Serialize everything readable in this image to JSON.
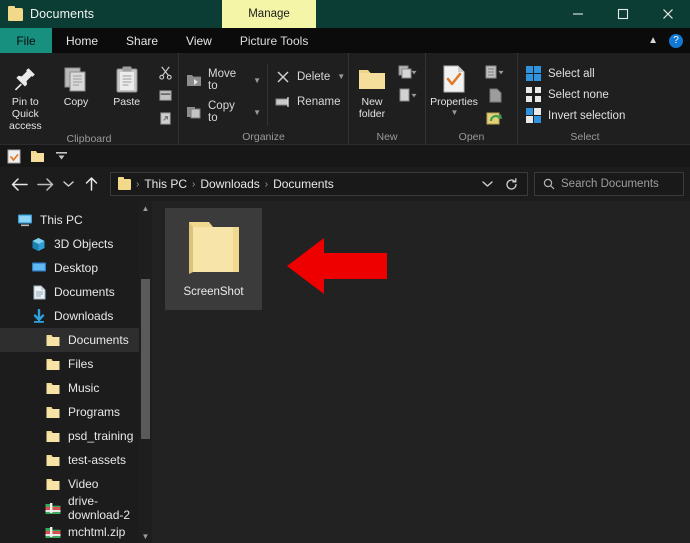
{
  "window": {
    "title": "Documents",
    "title_icon": "folder-icon",
    "contextual_tab": "Manage",
    "controls": {
      "minimize": "minimize-icon",
      "maximize": "maximize-icon",
      "close": "close-icon"
    },
    "accent_titlebar_color": "#0c3d34",
    "contextual_tab_color": "#f5f5a8"
  },
  "tabs": [
    {
      "label": "File",
      "active": true,
      "color": "#17907f"
    },
    {
      "label": "Home",
      "active": false
    },
    {
      "label": "Share",
      "active": false
    },
    {
      "label": "View",
      "active": false
    },
    {
      "label": "Picture Tools",
      "active": false
    }
  ],
  "tabstrip_right": {
    "collapse_ribbon": "chevron-up-icon",
    "help": "help-icon"
  },
  "ribbon": {
    "groups": [
      {
        "label": "Clipboard",
        "big_buttons": [
          {
            "label": "Pin to Quick access",
            "icon": "pin-icon"
          },
          {
            "label": "Copy",
            "icon": "copy-icon"
          },
          {
            "label": "Paste",
            "icon": "paste-icon"
          }
        ],
        "small_buttons": [
          {
            "name": "cut-icon",
            "tooltip": "Cut"
          },
          {
            "name": "copy-path-icon",
            "tooltip": "Copy path"
          },
          {
            "name": "paste-shortcut-icon",
            "tooltip": "Paste shortcut"
          }
        ]
      },
      {
        "label": "Organize",
        "items": [
          {
            "label": "Move to",
            "icon": "move-to-icon",
            "has_caret": true
          },
          {
            "label": "Copy to",
            "icon": "copy-to-icon",
            "has_caret": true
          },
          {
            "label": "Delete",
            "icon": "delete-icon",
            "has_caret": true
          },
          {
            "label": "Rename",
            "icon": "rename-icon",
            "has_caret": false
          }
        ]
      },
      {
        "label": "New",
        "big_buttons": [
          {
            "label": "New folder",
            "icon": "new-folder-icon"
          }
        ],
        "small_buttons": [
          {
            "name": "new-item-icon",
            "tooltip": "New item",
            "has_caret": true
          },
          {
            "name": "easy-access-icon",
            "tooltip": "Easy access",
            "has_caret": true
          }
        ]
      },
      {
        "label": "Open",
        "big_buttons": [
          {
            "label": "Properties",
            "icon": "properties-icon",
            "has_caret": true
          }
        ],
        "small_buttons": [
          {
            "name": "open-icon",
            "tooltip": "Open",
            "has_caret": true
          },
          {
            "name": "edit-icon",
            "tooltip": "Edit"
          },
          {
            "name": "history-icon",
            "tooltip": "History"
          }
        ]
      },
      {
        "label": "Select",
        "items": [
          {
            "label": "Select all",
            "icon": "select-all-icon"
          },
          {
            "label": "Select none",
            "icon": "select-none-icon"
          },
          {
            "label": "Invert selection",
            "icon": "invert-selection-icon"
          }
        ]
      }
    ]
  },
  "quick_access": [
    {
      "name": "properties-icon"
    },
    {
      "name": "new-folder-icon"
    },
    {
      "name": "customize-dropdown-icon"
    }
  ],
  "address_bar": {
    "back": "back-arrow-icon",
    "forward": "forward-arrow-icon",
    "recent": "chevron-down-icon",
    "up": "up-arrow-icon",
    "path_icon": "folder-icon",
    "breadcrumbs": [
      "This PC",
      "Downloads",
      "Documents"
    ],
    "separator": "›",
    "dropdown": "chevron-down-icon",
    "refresh": "refresh-icon"
  },
  "search": {
    "icon": "search-icon",
    "placeholder": "Search Documents",
    "value": ""
  },
  "sidebar": {
    "items": [
      {
        "label": "This PC",
        "icon": "this-pc-icon",
        "level": 0,
        "selected": false
      },
      {
        "label": "3D Objects",
        "icon": "3d-objects-icon",
        "level": 1,
        "selected": false
      },
      {
        "label": "Desktop",
        "icon": "desktop-icon",
        "level": 1,
        "selected": false
      },
      {
        "label": "Documents",
        "icon": "documents-icon",
        "level": 1,
        "selected": false
      },
      {
        "label": "Downloads",
        "icon": "downloads-icon",
        "level": 1,
        "selected": false
      },
      {
        "label": "Documents",
        "icon": "folder-icon",
        "level": 2,
        "selected": true
      },
      {
        "label": "Files",
        "icon": "folder-icon",
        "level": 2,
        "selected": false
      },
      {
        "label": "Music",
        "icon": "folder-icon",
        "level": 2,
        "selected": false
      },
      {
        "label": "Programs",
        "icon": "folder-icon",
        "level": 2,
        "selected": false
      },
      {
        "label": "psd_training",
        "icon": "folder-icon",
        "level": 2,
        "selected": false
      },
      {
        "label": "test-assets",
        "icon": "folder-icon",
        "level": 2,
        "selected": false
      },
      {
        "label": "Video",
        "icon": "folder-icon",
        "level": 2,
        "selected": false
      },
      {
        "label": "drive-download-2",
        "icon": "zip-icon",
        "level": 2,
        "selected": false
      },
      {
        "label": "mchtml.zip",
        "icon": "zip-icon",
        "level": 2,
        "selected": false
      }
    ],
    "scrollbar": {
      "up": "scroll-up-icon",
      "down": "scroll-down-icon"
    }
  },
  "content": {
    "files": [
      {
        "name": "ScreenShot",
        "icon": "folder-icon",
        "selected": true
      }
    ],
    "annotation": {
      "type": "red-arrow-left",
      "color": "#ee0000"
    }
  }
}
